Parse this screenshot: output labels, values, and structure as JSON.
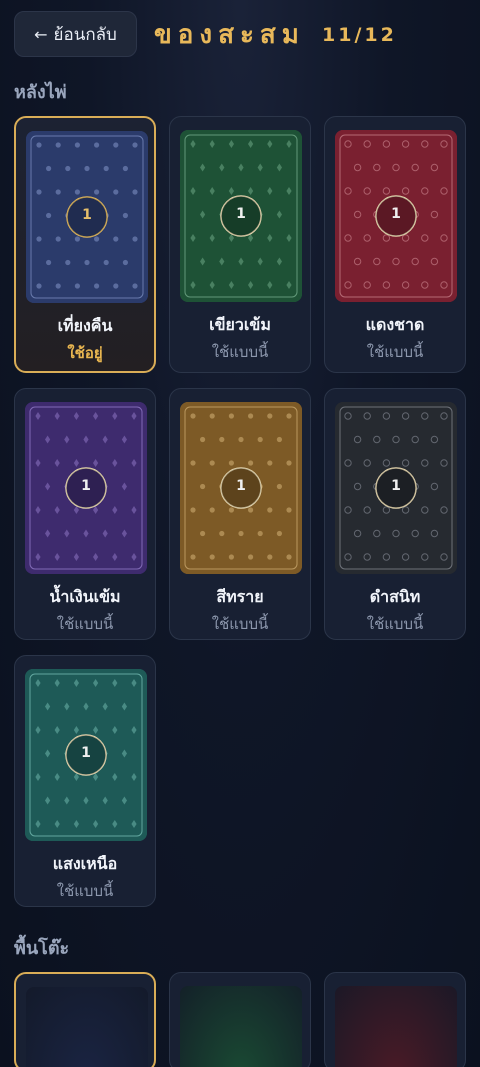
{
  "header": {
    "back_label": "ย้อนกลับ",
    "back_arrow": "←",
    "title": "ของสะสม",
    "counter": "11/12"
  },
  "sections": {
    "card_backs_label": "หลังไพ่",
    "table_label": "พื้นโต๊ะ"
  },
  "card_backs": [
    {
      "name": "เที่ยงคืน",
      "status": "ใช้อยู่",
      "badge": "1",
      "bg": "#2b3b6b",
      "accent": "#8395c8",
      "pattern": "dots",
      "selected": true
    },
    {
      "name": "เขียวเข้ม",
      "status": "ใช้แบบนี้",
      "badge": "1",
      "bg": "#1e5236",
      "accent": "#7fb796",
      "pattern": "diamonds",
      "selected": false
    },
    {
      "name": "แดงชาด",
      "status": "ใช้แบบนี้",
      "badge": "1",
      "bg": "#7a2030",
      "accent": "#cf8a93",
      "pattern": "rings",
      "selected": false
    },
    {
      "name": "น้ำเงินเข้ม",
      "status": "ใช้แบบนี้",
      "badge": "1",
      "bg": "#3e2b6e",
      "accent": "#9d86d4",
      "pattern": "diamonds",
      "selected": false
    },
    {
      "name": "สีทราย",
      "status": "ใช้แบบนี้",
      "badge": "1",
      "bg": "#7d5a26",
      "accent": "#d4b277",
      "pattern": "dots",
      "selected": false
    },
    {
      "name": "ดำสนิท",
      "status": "ใช้แบบนี้",
      "badge": "1",
      "bg": "#262a30",
      "accent": "#8b9099",
      "pattern": "rings",
      "selected": false
    },
    {
      "name": "แสงเหนือ",
      "status": "ใช้แบบนี้",
      "badge": "1",
      "bg": "#1e5a57",
      "accent": "#7fc8bd",
      "pattern": "diamonds",
      "selected": false
    }
  ],
  "tables": [
    {
      "color": "#1a2442",
      "selected": true
    },
    {
      "color": "#1a4a33",
      "selected": false
    },
    {
      "color": "#4a1a26",
      "selected": false
    }
  ]
}
